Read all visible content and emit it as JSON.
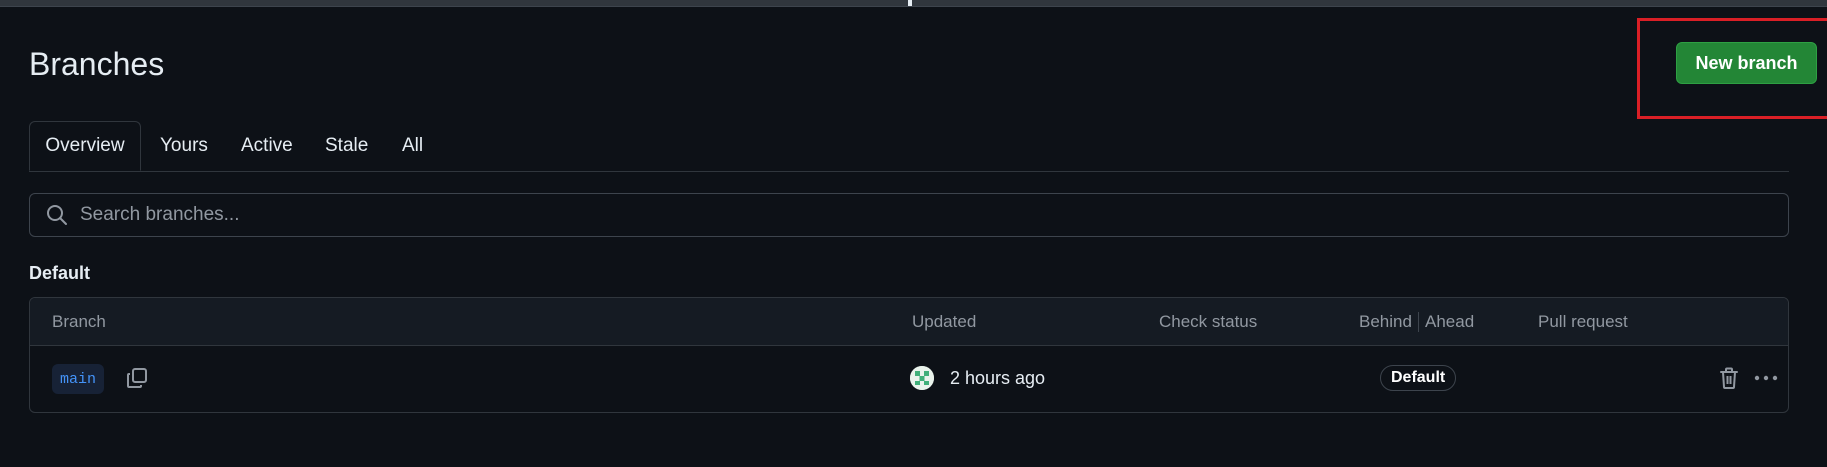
{
  "page": {
    "title": "Branches",
    "new_branch_label": "New branch"
  },
  "tabs": [
    {
      "label": "Overview",
      "selected": true
    },
    {
      "label": "Yours",
      "selected": false
    },
    {
      "label": "Active",
      "selected": false
    },
    {
      "label": "Stale",
      "selected": false
    },
    {
      "label": "All",
      "selected": false
    }
  ],
  "search": {
    "placeholder": "Search branches...",
    "value": ""
  },
  "sections": {
    "default_label": "Default"
  },
  "table": {
    "columns": {
      "branch": "Branch",
      "updated": "Updated",
      "check_status": "Check status",
      "behind": "Behind",
      "ahead": "Ahead",
      "pull_request": "Pull request"
    },
    "rows": [
      {
        "branch": "main",
        "updated": "2 hours ago",
        "badge": "Default"
      }
    ]
  },
  "colors": {
    "background": "#0d1117",
    "primary_button": "#238636",
    "highlight": "#d91f26",
    "link": "#4493f8"
  },
  "icons": [
    "search-icon",
    "copy-icon",
    "avatar",
    "trash-icon",
    "kebab-horizontal-icon"
  ]
}
